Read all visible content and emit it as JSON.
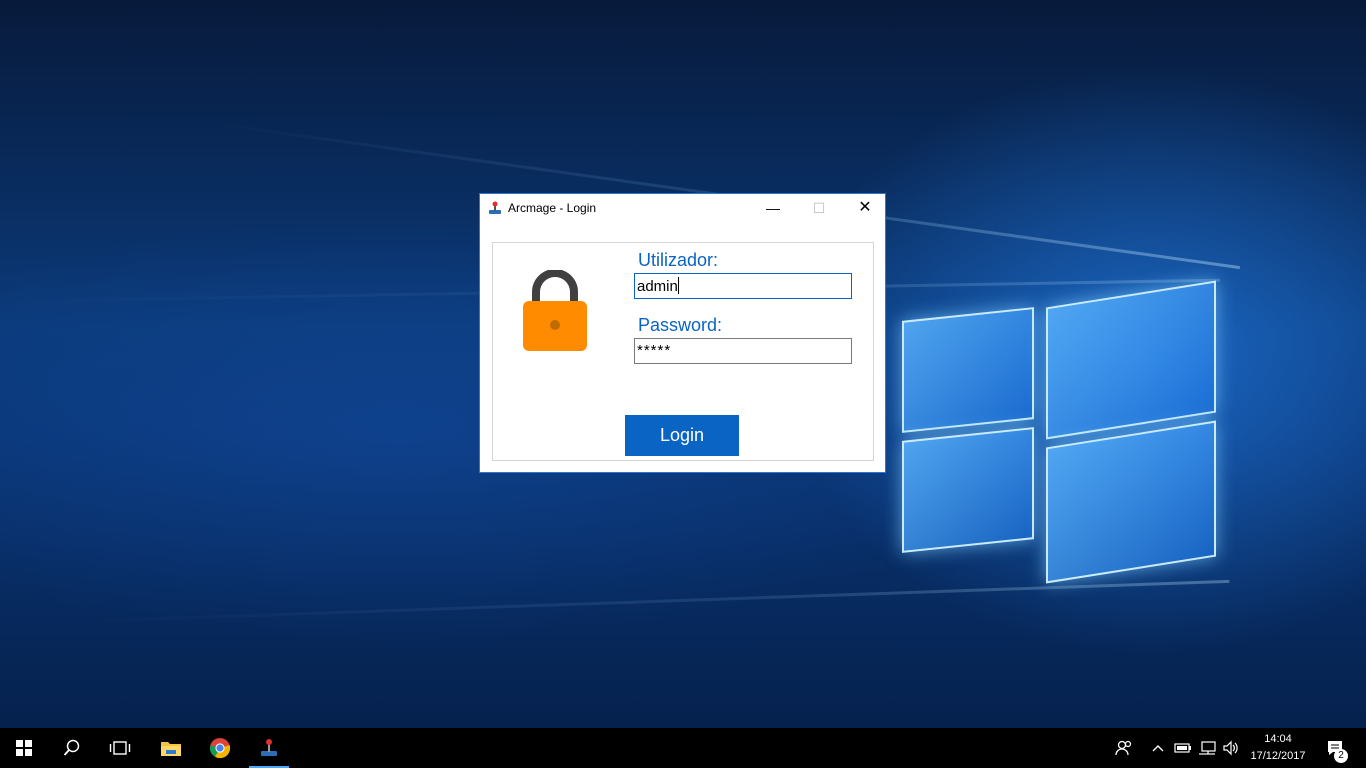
{
  "window": {
    "title": "Arcmage - Login",
    "minimize_glyph": "—",
    "maximize_glyph": "☐",
    "close_glyph": "✕",
    "icon": "app-joystick-icon"
  },
  "form": {
    "username_label": "Utilizador:",
    "username_value": "admin",
    "password_label": "Password:",
    "password_value": "*****",
    "login_label": "Login",
    "lock_icon": "padlock-icon",
    "colors": {
      "accent": "#0a64c4",
      "lock": "#ff8c00"
    }
  },
  "taskbar": {
    "items": [
      "start-icon",
      "search-icon",
      "task-view-icon",
      "file-explorer-icon",
      "chrome-icon",
      "arcmage-icon"
    ],
    "tray_icons": [
      "people-icon",
      "chevron-up-icon",
      "battery-icon",
      "network-icon",
      "volume-icon"
    ],
    "time": "14:04",
    "date": "17/12/2017",
    "notification_count": "2"
  }
}
